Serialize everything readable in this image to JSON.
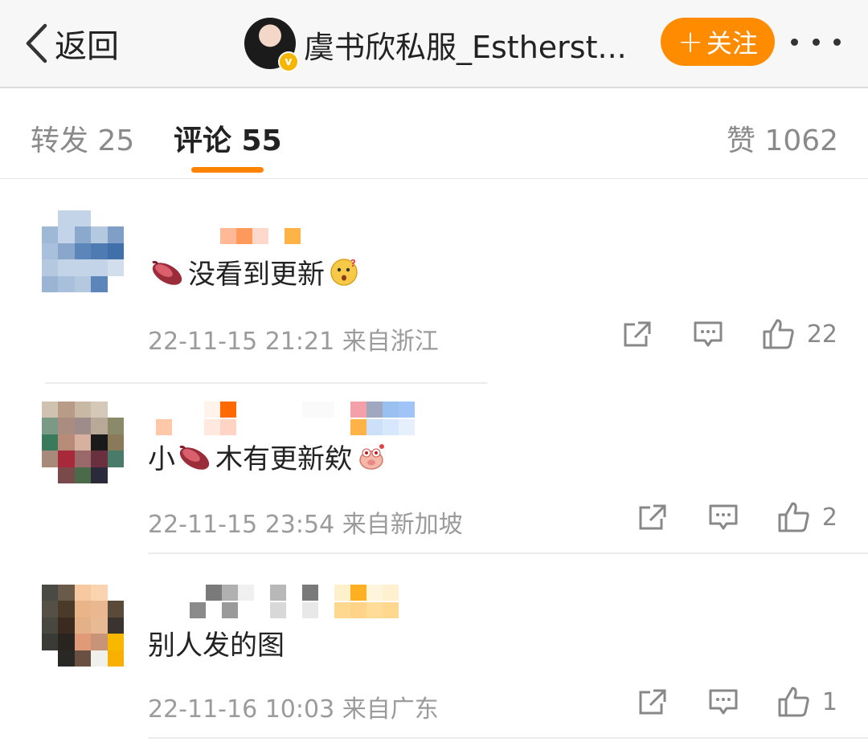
{
  "header": {
    "back_label": "返回",
    "username": "虞书欣私服_Estherst...",
    "follow_label": "关注"
  },
  "tabs": [
    {
      "label": "转发 25"
    },
    {
      "label": "评论 55"
    },
    {
      "label": "赞 1062"
    }
  ],
  "comments": [
    {
      "text": "没看到更新",
      "time": "22-11-15 21:21 来自浙江",
      "likes": "22"
    },
    {
      "text_prefix": "小",
      "text": "木有更新欸",
      "time": "22-11-15 23:54 来自新加坡",
      "likes": "2"
    },
    {
      "text": "别人发的图",
      "time": "22-11-16 10:03 来自广东",
      "likes": "1"
    }
  ],
  "colors": {
    "accent": "#ff8200",
    "follow_button": "#ff8c00",
    "verified_badge": "#f6b500"
  }
}
